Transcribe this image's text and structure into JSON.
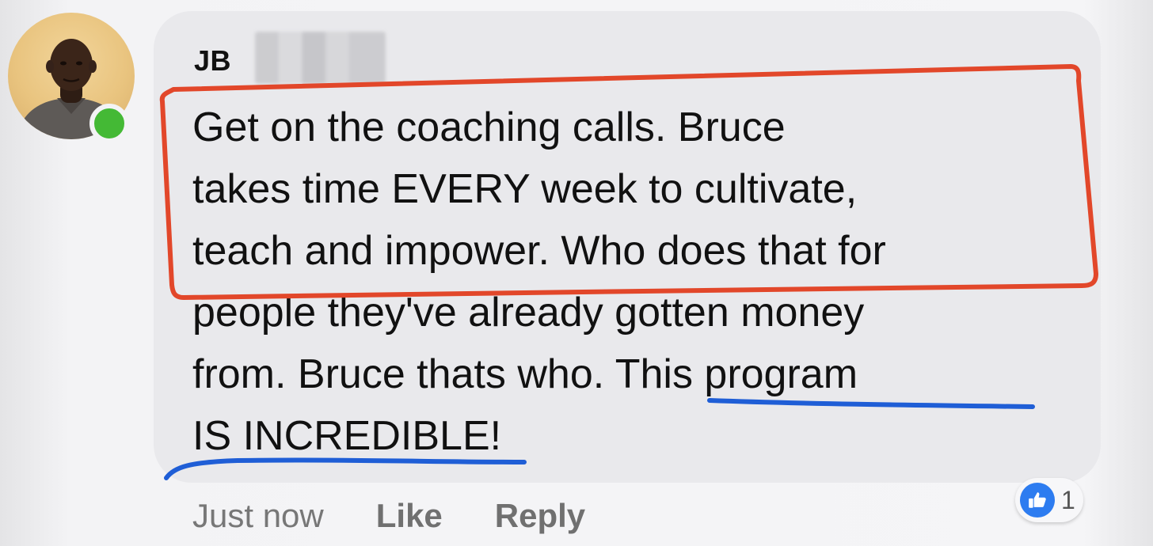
{
  "comment": {
    "author": "JB",
    "lines": [
      "Get on the coaching calls.  Bruce",
      "takes time EVERY week to cultivate,",
      "teach and impower. Who does that for",
      "people they've already gotten money",
      "from.  Bruce thats who. This program",
      "IS INCREDIBLE!"
    ],
    "timestamp": "Just now",
    "like_label": "Like",
    "reply_label": "Reply",
    "reaction_count": "1",
    "reaction_icon": "thumbs-up-icon"
  },
  "colors": {
    "highlight_box": "#e2472a",
    "underline": "#1f5ed6",
    "bubble": "#e9e9ec",
    "presence": "#44b935",
    "like_blue": "#2d7cf0"
  }
}
